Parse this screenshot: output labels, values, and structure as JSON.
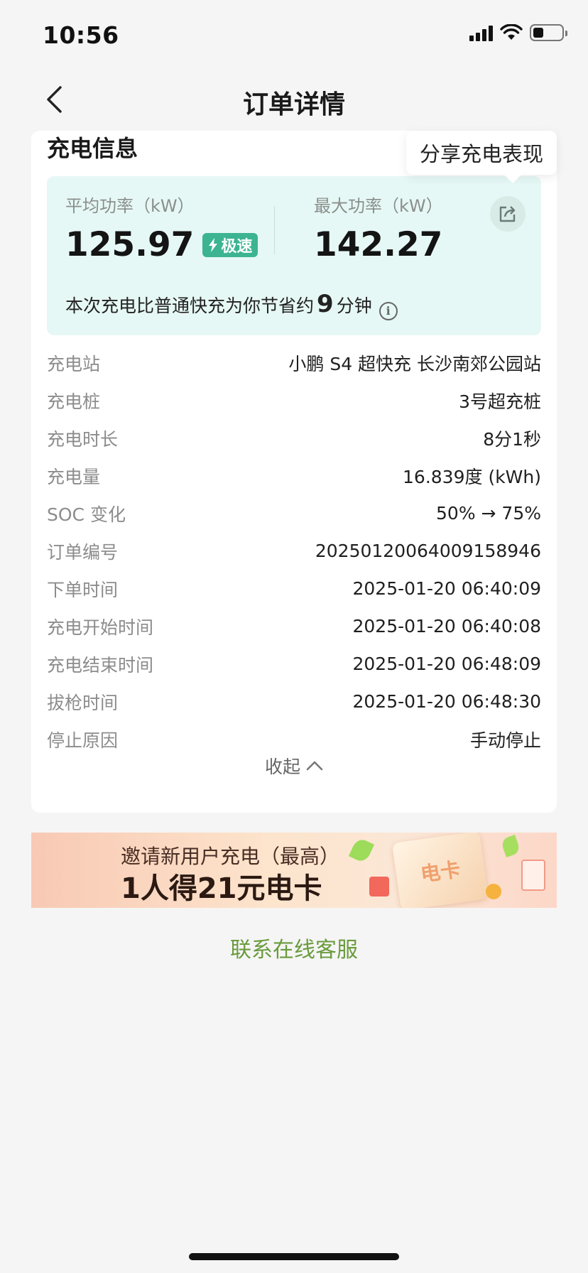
{
  "status_bar": {
    "time": "10:56"
  },
  "nav": {
    "title": "订单详情"
  },
  "tooltip": {
    "text": "分享充电表现"
  },
  "section": {
    "title": "充电信息"
  },
  "power": {
    "avg_label": "平均功率（kW）",
    "avg_value": "125.97",
    "badge": "极速",
    "max_label": "最大功率（kW）",
    "max_value": "142.27",
    "saving_prefix": "本次充电比普通快充为你节省约",
    "saving_minutes": "9",
    "saving_suffix": "分钟"
  },
  "details": [
    {
      "key": "充电站",
      "value": "小鹏 S4 超快充 长沙南郊公园站"
    },
    {
      "key": "充电桩",
      "value": "3号超充桩"
    },
    {
      "key": "充电时长",
      "value": "8分1秒"
    },
    {
      "key": "充电量",
      "value": "16.839度 (kWh)"
    },
    {
      "key": "SOC 变化",
      "value": "50% → 75%"
    },
    {
      "key": "订单编号",
      "value": "20250120064009158946"
    },
    {
      "key": "下单时间",
      "value": "2025-01-20 06:40:09"
    },
    {
      "key": "充电开始时间",
      "value": "2025-01-20 06:40:08"
    },
    {
      "key": "充电结束时间",
      "value": "2025-01-20 06:48:09"
    },
    {
      "key": "拔枪时间",
      "value": "2025-01-20 06:48:30"
    },
    {
      "key": "停止原因",
      "value": "手动停止"
    }
  ],
  "collapse_label": "收起",
  "banner": {
    "line1": "邀请新用户充电（最高）",
    "line2": "1人得21元电卡",
    "card_text": "电卡"
  },
  "contact": "联系在线客服",
  "colors": {
    "accent_teal": "#3cb491",
    "panel_bg": "#e6f8f5",
    "contact_green": "#6a9b3d"
  }
}
